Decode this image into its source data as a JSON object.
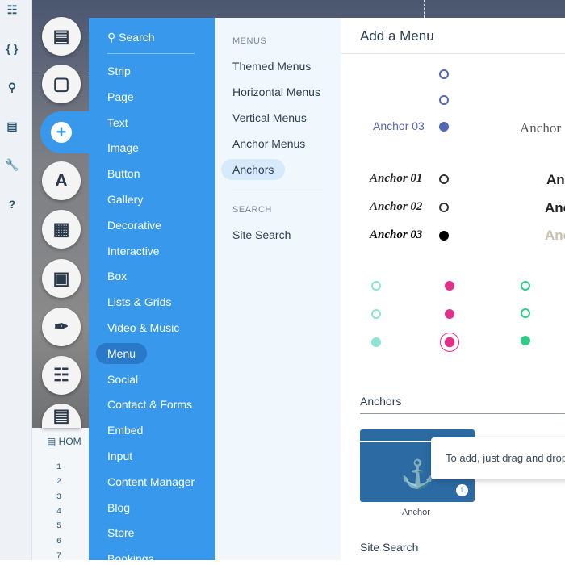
{
  "toolbar": {
    "icons": [
      "page-code-icon",
      "braces-icon",
      "search-icon",
      "table-icon",
      "wrench-icon",
      "help-icon"
    ],
    "braces": "{ }",
    "help": "?"
  },
  "editor": {
    "page": "HOM",
    "lines": [
      "1",
      "2",
      "3",
      "4",
      "5",
      "6",
      "7"
    ]
  },
  "categories": {
    "search": "Search",
    "items": [
      "Strip",
      "Page",
      "Text",
      "Image",
      "Button",
      "Gallery",
      "Decorative",
      "Interactive",
      "Box",
      "Lists & Grids",
      "Video & Music",
      "Menu",
      "Social",
      "Contact & Forms",
      "Embed",
      "Input",
      "Content Manager",
      "Blog",
      "Store",
      "Bookings"
    ],
    "selected": "Menu"
  },
  "submenu": {
    "header1": "MENUS",
    "items": [
      "Themed Menus",
      "Horizontal Menus",
      "Vertical Menus",
      "Anchor Menus",
      "Anchors"
    ],
    "selected": "Anchors",
    "header2": "SEARCH",
    "search_items": [
      "Site Search"
    ]
  },
  "panel": {
    "title": "Add a Menu",
    "preview1_label": "Anchor 03",
    "preview2_label": "Anchor",
    "preview3_labels": [
      "Anchor 01",
      "Anchor 02",
      "Anchor 03"
    ],
    "preview4_labels": [
      "Anc",
      "Anc",
      "Anc"
    ],
    "section_anchors": "Anchors",
    "anchor_item": "Anchor",
    "tooltip": "To add, just drag and drop",
    "section_search": "Site Search"
  },
  "colors": {
    "accent": "#3899ec",
    "selected": "#2a78c8",
    "pink": "#e0308a",
    "teal": "#8de4d3",
    "green": "#2ecc85",
    "navy": "#5268b5"
  }
}
